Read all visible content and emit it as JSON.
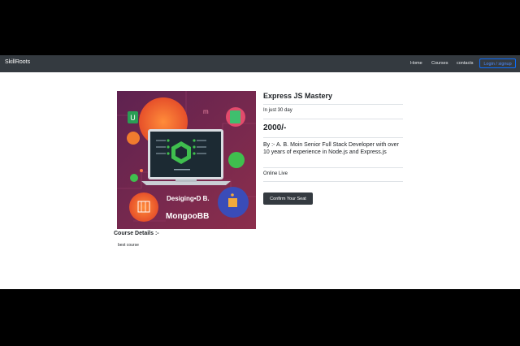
{
  "navbar": {
    "brand": "SkillRoots",
    "links": [
      "Home",
      "Courses",
      "contacts"
    ],
    "login_label": "Login / signup"
  },
  "course": {
    "title": "Express JS Mastery",
    "duration": "In just 30 day",
    "price": "2000/-",
    "instructor": "By :- A. B. Moin Senior Full Stack Developer with over 10 years of experience in Node.js and Express.js",
    "mode": "Online Live",
    "confirm_label": "Confirm Your Seat",
    "image": {
      "caption_top": "Desiging•D B.",
      "caption_bottom": "MongooBB"
    }
  },
  "details": {
    "heading": "Course Details :-",
    "text": "best course"
  },
  "colors": {
    "navbar_bg": "#343a40",
    "button_bg": "#343a40",
    "accent_login": "#0d6efd",
    "image_bg": "#7b2a52"
  }
}
